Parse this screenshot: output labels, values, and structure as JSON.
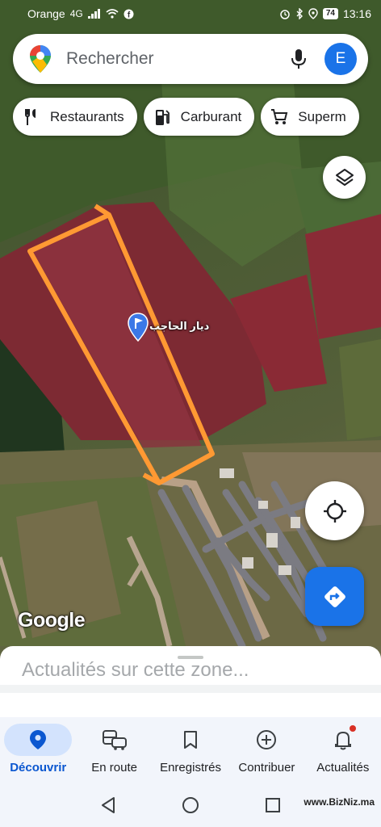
{
  "status_bar": {
    "carrier": "Orange",
    "network": "4G",
    "battery": "74",
    "time": "13:16"
  },
  "search": {
    "placeholder": "Rechercher",
    "avatar_letter": "E"
  },
  "chips": [
    {
      "label": "Restaurants",
      "icon": "restaurant-icon"
    },
    {
      "label": "Carburant",
      "icon": "gas-station-icon"
    },
    {
      "label": "Superm",
      "icon": "shopping-cart-icon"
    }
  ],
  "map": {
    "place_label": "ديار الحاجب",
    "attribution": "Google"
  },
  "sheet": {
    "title": "Actualités sur cette zone..."
  },
  "bottom_nav": [
    {
      "label": "Découvrir",
      "icon": "explore-pin-icon",
      "active": true
    },
    {
      "label": "En route",
      "icon": "commute-icon",
      "active": false
    },
    {
      "label": "Enregistrés",
      "icon": "bookmark-icon",
      "active": false
    },
    {
      "label": "Contribuer",
      "icon": "add-circle-icon",
      "active": false
    },
    {
      "label": "Actualités",
      "icon": "bell-icon",
      "active": false,
      "badge": true
    }
  ],
  "watermark": "www.BizNiz.ma",
  "colors": {
    "accent": "#1a73e8",
    "boundary": "#ff9933",
    "field_red": "#8b2b36"
  }
}
